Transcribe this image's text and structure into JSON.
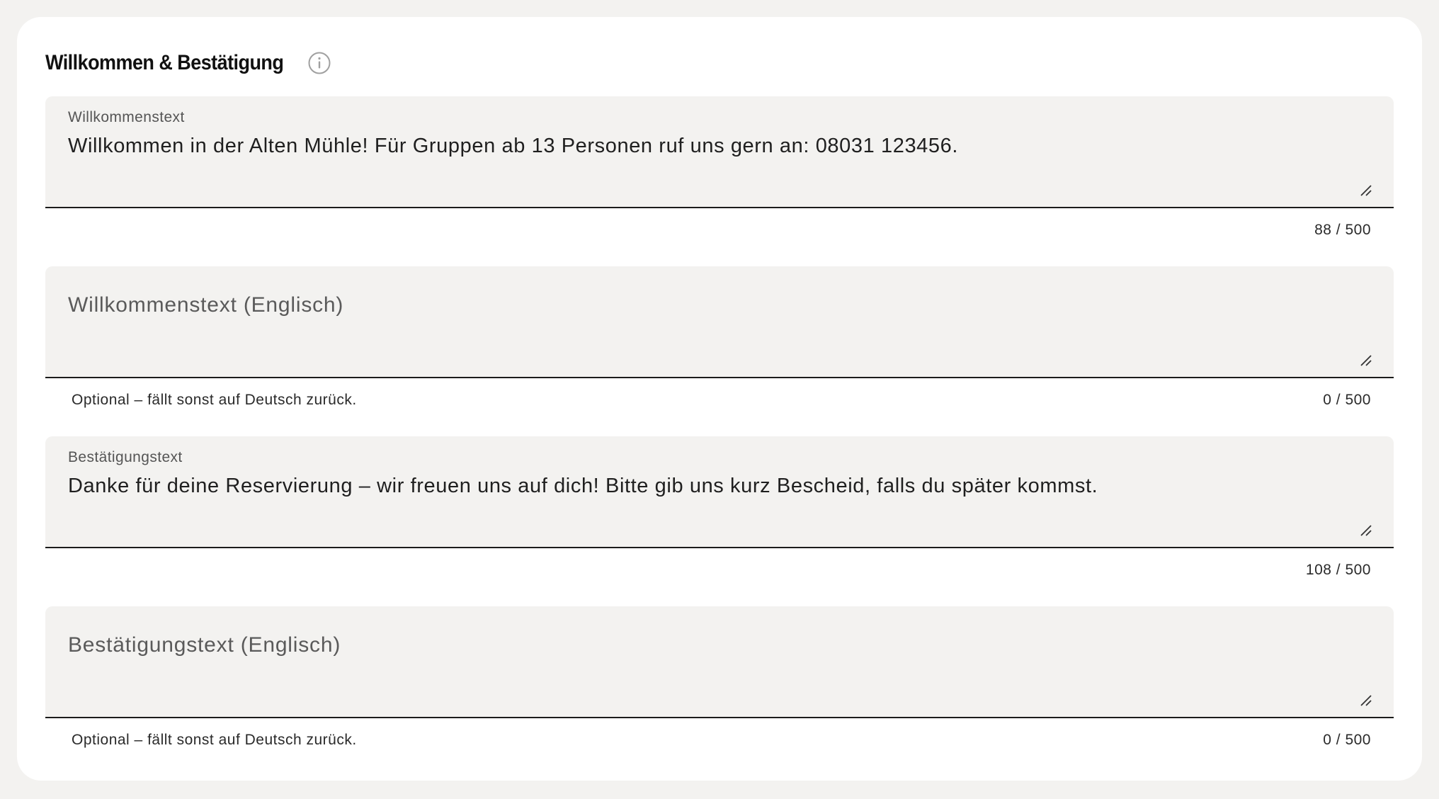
{
  "section": {
    "title": "Willkommen & Bestätigung",
    "info_icon": "info-circle-icon"
  },
  "fields": [
    {
      "label": "Willkommenstext",
      "value": "Willkommen in der Alten Mühle! Für Gruppen ab 13 Personen ruf uns gern an: 08031 123456.",
      "placeholder": "",
      "helper": "",
      "count": "88 / 500"
    },
    {
      "label": "",
      "value": "",
      "placeholder": "Willkommenstext (Englisch)",
      "helper": "Optional – fällt sonst auf Deutsch zurück.",
      "count": "0 / 500"
    },
    {
      "label": "Bestätigungstext",
      "value": "Danke für deine Reservierung – wir freuen uns auf dich! Bitte gib uns kurz Bescheid, falls du später kommst.",
      "placeholder": "",
      "helper": "",
      "count": "108 / 500"
    },
    {
      "label": "",
      "value": "",
      "placeholder": "Bestätigungstext (Englisch)",
      "helper": "Optional – fällt sonst auf Deutsch zurück.",
      "count": "0 / 500"
    }
  ],
  "icons": {
    "resize": "resize-handle-icon"
  },
  "colors": {
    "page_background": "#f3f2f0",
    "card_background": "#ffffff",
    "field_background": "#f3f2f0",
    "field_underline": "#1c1c1c",
    "info_icon": "#9a9a9a"
  }
}
